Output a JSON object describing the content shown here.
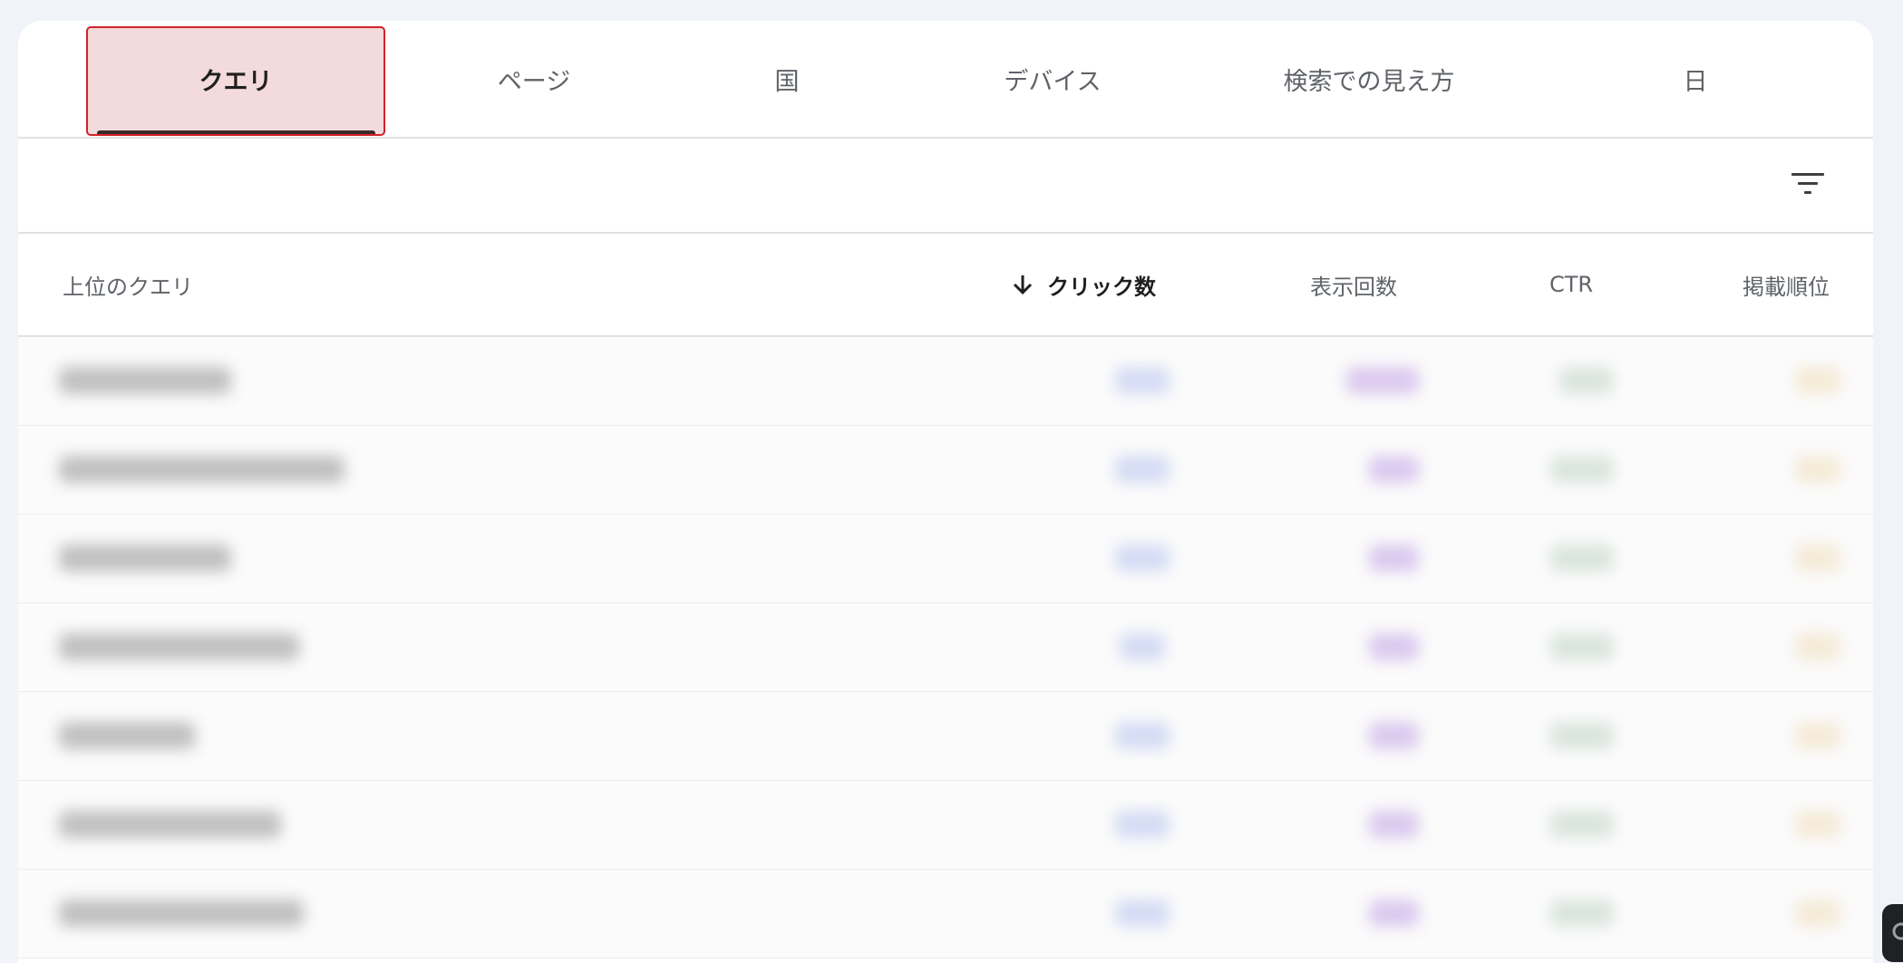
{
  "tabs": [
    {
      "label": "クエリ",
      "active": true
    },
    {
      "label": "ページ",
      "active": false
    },
    {
      "label": "国",
      "active": false
    },
    {
      "label": "デバイス",
      "active": false
    },
    {
      "label": "検索での見え方",
      "active": false
    },
    {
      "label": "日",
      "active": false
    }
  ],
  "toolbar": {
    "filter_icon": "filter-list-icon"
  },
  "table": {
    "columns": [
      {
        "label": "上位のクエリ",
        "sorted": false
      },
      {
        "label": "クリック数",
        "sorted": true,
        "sort_direction": "descending"
      },
      {
        "label": "表示回数",
        "sorted": false
      },
      {
        "label": "CTR",
        "sorted": false
      },
      {
        "label": "掲載順位",
        "sorted": false
      }
    ],
    "rows_blurred": true
  },
  "colors": {
    "active_tab_highlight": "#f3dadb",
    "highlight_border": "#d3212b",
    "page_background": "#f0f4f9"
  }
}
